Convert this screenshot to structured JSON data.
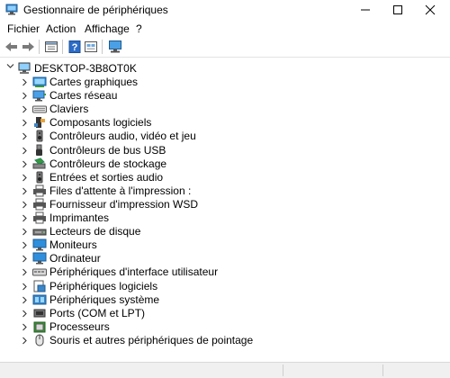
{
  "window": {
    "title": "Gestionnaire de périphériques",
    "controls": [
      "minimize-icon",
      "maximize-icon",
      "close-icon"
    ]
  },
  "menu": [
    "Fichier",
    "Action",
    "Affichage",
    "?"
  ],
  "toolbar": {
    "buttons": [
      "back-arrow-icon",
      "forward-arrow-icon",
      "properties-icon",
      "help-icon",
      "show-hidden-icon",
      "scan-hardware-icon"
    ]
  },
  "tree": {
    "root": "DESKTOP-3B8OT0K",
    "items": [
      {
        "label": "Cartes graphiques",
        "icon": "display-adapter-icon"
      },
      {
        "label": "Cartes réseau",
        "icon": "network-adapter-icon"
      },
      {
        "label": "Claviers",
        "icon": "keyboard-icon"
      },
      {
        "label": "Composants logiciels",
        "icon": "software-component-icon"
      },
      {
        "label": "Contrôleurs audio, vidéo et jeu",
        "icon": "speaker-icon"
      },
      {
        "label": "Contrôleurs de bus USB",
        "icon": "usb-icon"
      },
      {
        "label": "Contrôleurs de stockage",
        "icon": "storage-controller-icon"
      },
      {
        "label": "Entrées et sorties audio",
        "icon": "speaker-icon"
      },
      {
        "label": "Files d'attente à l'impression :",
        "icon": "printer-icon"
      },
      {
        "label": "Fournisseur d'impression WSD",
        "icon": "printer-icon"
      },
      {
        "label": "Imprimantes",
        "icon": "printer-icon"
      },
      {
        "label": "Lecteurs de disque",
        "icon": "disk-drive-icon"
      },
      {
        "label": "Moniteurs",
        "icon": "monitor-icon"
      },
      {
        "label": "Ordinateur",
        "icon": "monitor-icon"
      },
      {
        "label": "Périphériques d'interface utilisateur",
        "icon": "hid-icon"
      },
      {
        "label": "Périphériques logiciels",
        "icon": "software-device-icon"
      },
      {
        "label": "Périphériques système",
        "icon": "system-device-icon"
      },
      {
        "label": "Ports (COM et LPT)",
        "icon": "port-icon"
      },
      {
        "label": "Processeurs",
        "icon": "processor-icon"
      },
      {
        "label": "Souris et autres périphériques de pointage",
        "icon": "mouse-icon"
      }
    ]
  }
}
